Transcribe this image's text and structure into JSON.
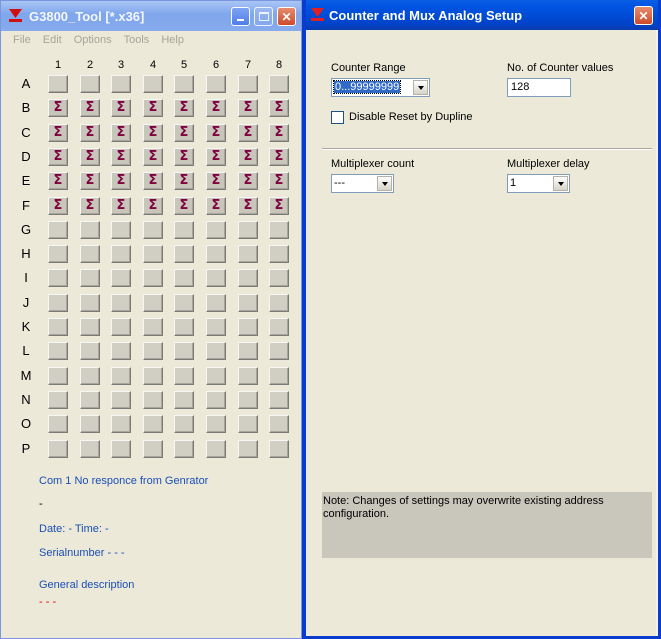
{
  "left_window": {
    "title": "G3800_Tool [*.x36]",
    "menu": [
      "File",
      "Edit",
      "Options",
      "Tools",
      "Help"
    ],
    "columns": [
      "1",
      "2",
      "3",
      "4",
      "5",
      "6",
      "7",
      "8"
    ],
    "rows": [
      "A",
      "B",
      "C",
      "D",
      "E",
      "F",
      "G",
      "H",
      "I",
      "J",
      "K",
      "L",
      "M",
      "N",
      "O",
      "P"
    ],
    "sigma_rows": [
      "B",
      "C",
      "D",
      "E",
      "F"
    ],
    "sigma_glyph": "Σ",
    "status": "Com 1 No responce from Genrator",
    "dash": "-",
    "datetime": "Date: - Time: -",
    "serial": "Serialnumber - - -",
    "general_description": "General description",
    "red_dashes": "- - -"
  },
  "right_window": {
    "title": "Counter and Mux Analog Setup",
    "counter_range": {
      "label": "Counter Range",
      "value": "0...99999999"
    },
    "counter_values": {
      "label": "No. of Counter values",
      "value": "128"
    },
    "disable_reset": {
      "label": "Disable Reset by Dupline",
      "checked": false
    },
    "mux_count": {
      "label": "Multiplexer count",
      "value": "---"
    },
    "mux_delay": {
      "label": "Multiplexer delay",
      "value": "1"
    },
    "note": "Note: Changes of settings may overwrite existing address configuration."
  },
  "colors": {
    "title_active": "#0054e3",
    "title_inactive": "#7fa6ec",
    "sigma": "#800040",
    "link_text": "#1a4fb8",
    "red": "#e00000"
  }
}
